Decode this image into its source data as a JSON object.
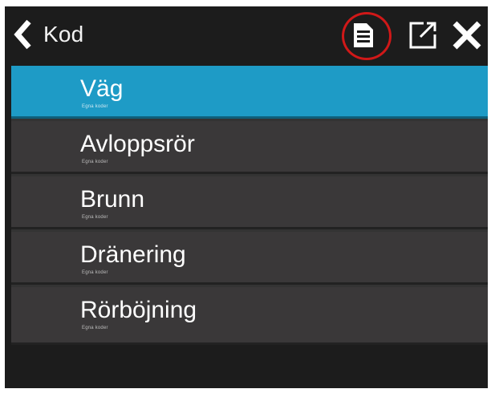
{
  "header": {
    "title": "Kod",
    "back_icon": "chevron-left-icon",
    "list_icon": "list-document-icon",
    "open_icon": "open-external-icon",
    "close_icon": "close-icon"
  },
  "items": [
    {
      "label": "Väg",
      "sub": "Egna koder",
      "selected": true
    },
    {
      "label": "Avloppsrör",
      "sub": "Egna koder",
      "selected": false
    },
    {
      "label": "Brunn",
      "sub": "Egna koder",
      "selected": false
    },
    {
      "label": "Dränering",
      "sub": "Egna koder",
      "selected": false
    },
    {
      "label": "Rörböjning",
      "sub": "Egna koder",
      "selected": false
    }
  ],
  "colors": {
    "background": "#1c1c1c",
    "item": "#3a3839",
    "selected": "#1e9bc6",
    "highlight_ring": "#d01818"
  }
}
